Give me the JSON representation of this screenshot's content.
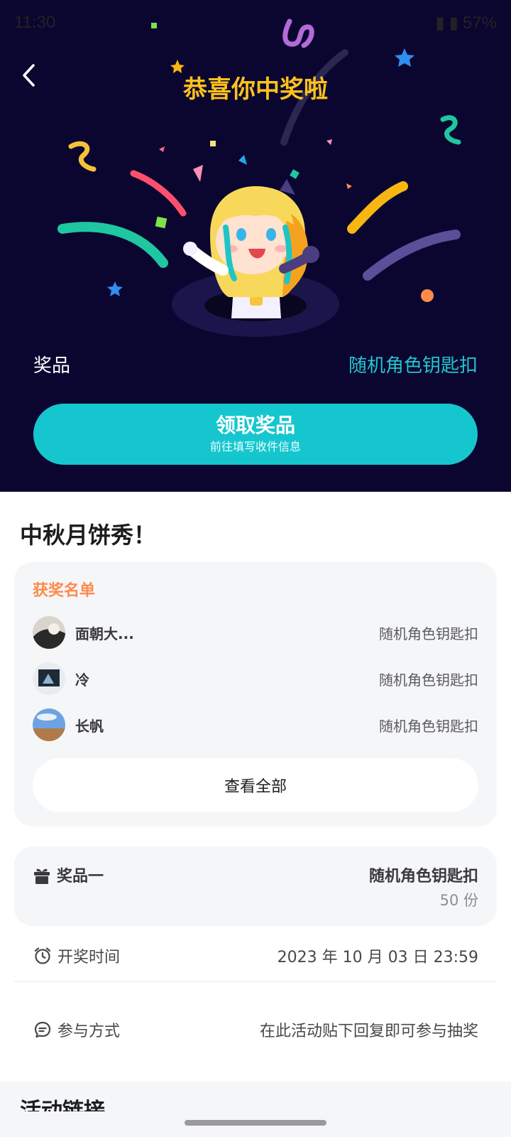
{
  "status_bar": {
    "time": "11:30",
    "battery": "57%"
  },
  "hero": {
    "title": "恭喜你中奖啦",
    "prize_label": "奖品",
    "prize_value": "随机角色钥匙扣",
    "claim_button": {
      "label": "领取奖品",
      "sublabel": "前往填写收件信息"
    }
  },
  "event": {
    "title": "中秋月饼秀！"
  },
  "winners": {
    "heading": "获奖名单",
    "items": [
      {
        "name": "面朝大...",
        "prize": "随机角色钥匙扣"
      },
      {
        "name": "冷",
        "prize": "随机角色钥匙扣"
      },
      {
        "name": "长帆",
        "prize": "随机角色钥匙扣"
      }
    ],
    "view_all_label": "查看全部"
  },
  "prize_card": {
    "label": "奖品一",
    "name": "随机角色钥匙扣",
    "count": "50 份"
  },
  "draw_time": {
    "label": "开奖时间",
    "value": "2023 年 10 月 03 日 23:59"
  },
  "participation": {
    "label": "参与方式",
    "value": "在此活动贴下回复即可参与抽奖"
  },
  "next_section": {
    "heading": "活动链接"
  },
  "colors": {
    "hero_bg": "#0b0630",
    "accent_teal": "#16c6cf",
    "title_gold": "#ffc21a",
    "winners_heading": "#ff8a4c"
  }
}
